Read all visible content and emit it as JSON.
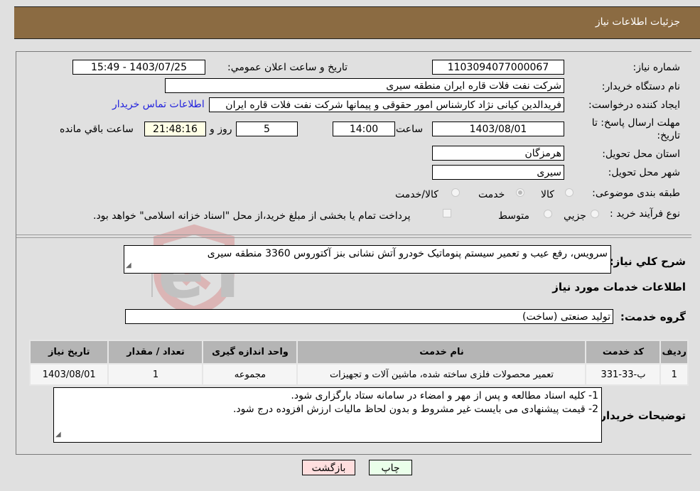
{
  "header": {
    "title": "جزئیات اطلاعات نیاز"
  },
  "fields": {
    "need_number_label": "شماره نیاز:",
    "need_number": "1103094077000067",
    "announce_label": "تاریخ و ساعت اعلان عمومي:",
    "announce_value": "1403/07/25 - 15:49",
    "buyer_org_label": "نام دستگاه خریدار:",
    "buyer_org": "شرکت نفت فلات قاره ایران منطقه سیری",
    "creator_label": "ایجاد کننده درخواست:",
    "creator": "فریدالدین کیانی نژاد کارشناس امور حقوقی و پیمانها شرکت نفت فلات قاره ایران",
    "contact_link": "اطلاعات تماس خریدار",
    "deadline_label_1": "مهلت ارسال پاسخ: تا",
    "deadline_label_2": "تاریخ:",
    "deadline_date": "1403/08/01",
    "time_label": "ساعت",
    "deadline_time": "14:00",
    "days_value": "5",
    "days_label": "روز و",
    "remaining_time": "21:48:16",
    "remaining_label": "ساعت باقي مانده",
    "province_label": "استان محل تحویل:",
    "province": "هرمزگان",
    "city_label": "شهر محل تحویل:",
    "city": "سیری",
    "category_label": "طبقه بندی موضوعی:",
    "category_options": [
      "کالا",
      "خدمت",
      "کالا/خدمت"
    ],
    "category_selected": "خدمت",
    "process_label": "نوع فرآیند خرید :",
    "process_options": [
      "جزیي",
      "متوسط"
    ],
    "treasury_note": "پرداخت تمام یا بخشی از مبلغ خرید،از محل \"اسناد خزانه اسلامی\" خواهد بود."
  },
  "description": {
    "label": "شرح کلي نیاز:",
    "value": "سرویس، رفع عیب و تعمیر سیستم پنوماتیک خودرو آتش نشانی بنز آکتوروس 3360 منطقه سیری"
  },
  "services": {
    "section_title": "اطلاعات خدمات مورد نیاز",
    "group_label": "گروه خدمت:",
    "group_value": "تولید صنعتی (ساخت)",
    "columns": [
      "ردیف",
      "کد خدمت",
      "نام خدمت",
      "واحد اندازه گیری",
      "تعداد / مقدار",
      "تاریخ نیاز"
    ],
    "rows": [
      [
        "1",
        "ب-33-331",
        "تعمیر محصولات فلزی ساخته شده، ماشین آلات و تجهیزات",
        "مجموعه",
        "1",
        "1403/08/01"
      ]
    ]
  },
  "buyer_notes": {
    "label": "توضیحات خریدار:",
    "lines": [
      "1- کلیه اسناد مطالعه و پس از مهر و امضاء در سامانه ستاد بارگزاری شود.",
      "2- قیمت پیشنهادی می بایست غیر مشروط و بدون لحاظ مالیات ارزش افزوده درج شود."
    ]
  },
  "buttons": {
    "print": "چاپ",
    "back": "بازگشت"
  },
  "colors": {
    "header_bg": "#8b6b42",
    "print_bg": "#eaffea",
    "back_bg": "#ffdede",
    "link": "#2222dd"
  }
}
